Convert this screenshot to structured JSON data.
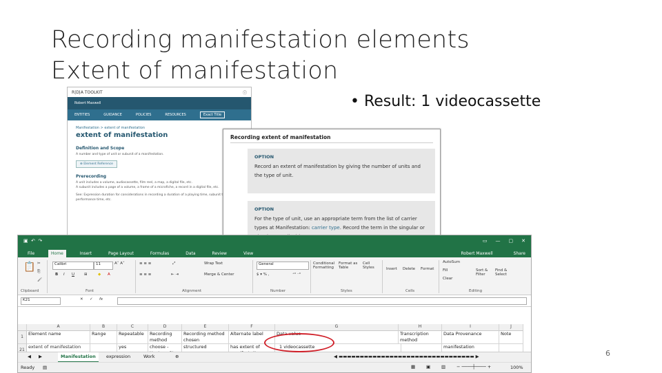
{
  "slide": {
    "title_line1": "Recording manifestation elements",
    "title_line2": "Extent of manifestation",
    "bullet": "• Result: 1 videocassette",
    "page_number": "6"
  },
  "rda": {
    "brand": "R|D|A TOOLKIT",
    "user": "Robert Maxwell",
    "nav": [
      "ENTITIES",
      "GUIDANCE",
      "POLICIES",
      "RESOURCES",
      "Exact Title"
    ],
    "breadcrumb": "Manifestation > extent of manifestation",
    "heading": "extent of manifestation",
    "def_heading": "Definition and Scope",
    "def_text": "A number and type of unit or subunit of a manifestation.",
    "element_ref": "Element Reference",
    "preread_heading": "Prerecording",
    "preread_text1": "A unit includes a volume, audiocassette, film reel, a map, a digital file, etc.",
    "preread_text2": "A subunit includes a page of a volume, a frame of a microfiche, a record in a digital file, etc.",
    "preread_text3": "See: Expression duration for considerations in recording a duration of a playing time, subunit types, performance time, etc."
  },
  "option_popup": {
    "title": "Recording extent of manifestation",
    "box1_label": "OPTION",
    "box1_text": "Record an extent of manifestation by giving the number of units and the type of unit.",
    "box2_label": "OPTION",
    "box2_text_a": "For the type of unit, use an appropriate term from the list of carrier types at Manifestation:",
    "box2_link": "carrier type",
    "box2_text_b": ". Record the term in the singular or plural, as applicable."
  },
  "excel": {
    "user": "Robert Maxwell",
    "share": "Share",
    "menu": [
      "File",
      "Home",
      "Insert",
      "Page Layout",
      "Formulas",
      "Data",
      "Review",
      "View"
    ],
    "font_name": "Calibri",
    "font_size": "11",
    "number_format": "General",
    "wrap_text": "Wrap Text",
    "merge_center": "Merge & Center",
    "groups": [
      "Clipboard",
      "Font",
      "Alignment",
      "Number",
      "Styles",
      "Cells",
      "Editing"
    ],
    "styles_btns": [
      "Conditional Formatting",
      "Format as Table",
      "Cell Styles"
    ],
    "cells_btns": [
      "Insert",
      "Delete",
      "Format"
    ],
    "editing_btns": [
      "AutoSum",
      "Fill",
      "Clear",
      "Sort & Filter",
      "Find & Select"
    ],
    "name_box": "K21",
    "fx": "fx",
    "columns": [
      "A",
      "B",
      "C",
      "D",
      "E",
      "F",
      "G",
      "H",
      "I",
      "J"
    ],
    "headers": [
      "Element name",
      "Range",
      "Repeatable",
      "Recording method",
      "Recording method chosen",
      "Alternate label",
      "Data value",
      "",
      "Transcription method",
      "Data Provenance",
      "Note"
    ],
    "row_values": [
      "extent of manifestation",
      "",
      "yes",
      "choose - Unstr or Str",
      "structured",
      "has extent of manifestation",
      "1 videocassette",
      "",
      "",
      "manifestation",
      ""
    ],
    "sheets": [
      "Manifestation",
      "expression",
      "Work"
    ],
    "status": "Ready",
    "zoom": "100%"
  }
}
